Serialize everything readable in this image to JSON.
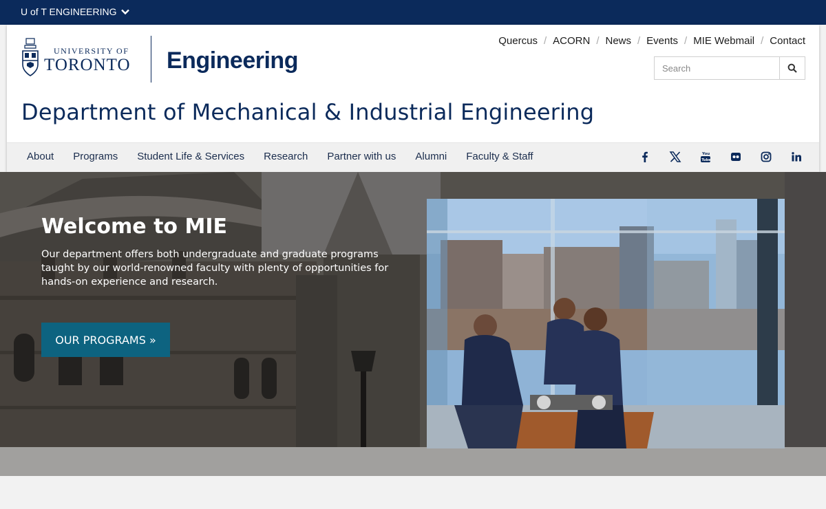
{
  "topbar": {
    "label": "U of T ENGINEERING"
  },
  "logo": {
    "university_small": "UNIVERSITY OF",
    "university_big": "TORONTO",
    "faculty": "Engineering"
  },
  "utility_links": [
    "Quercus",
    "ACORN",
    "News",
    "Events",
    "MIE Webmail",
    "Contact"
  ],
  "search": {
    "placeholder": "Search"
  },
  "department_title": "Department of Mechanical & Industrial Engineering",
  "nav": [
    "About",
    "Programs",
    "Student Life & Services",
    "Research",
    "Partner with us",
    "Alumni",
    "Faculty & Staff"
  ],
  "social": [
    "facebook-icon",
    "x-icon",
    "youtube-icon",
    "flickr-icon",
    "instagram-icon",
    "linkedin-icon"
  ],
  "hero": {
    "title": "Welcome to MIE",
    "text": "Our department offers both undergraduate and graduate programs taught by our world-renowned faculty with plenty of opportunities for hands-on experience and research.",
    "button": "OUR PROGRAMS »"
  },
  "colors": {
    "navy": "#0b2a5b",
    "button_teal": "#0d6380",
    "nav_bg": "#f0f0f0"
  }
}
